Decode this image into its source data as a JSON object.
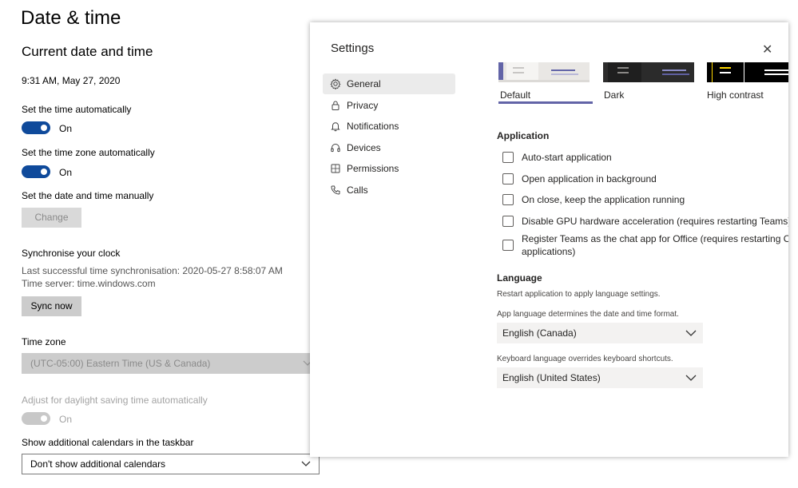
{
  "win": {
    "page_title": "Date & time",
    "section_title": "Current date and time",
    "current_datetime": "9:31 AM, May 27, 2020",
    "auto_time": {
      "label": "Set the time automatically",
      "state": "On"
    },
    "auto_zone": {
      "label": "Set the time zone automatically",
      "state": "On"
    },
    "manual": {
      "label": "Set the date and time manually",
      "button": "Change"
    },
    "sync": {
      "title": "Synchronise your clock",
      "last_sync": "Last successful time synchronisation: 2020-05-27 8:58:07 AM",
      "server": "Time server: time.windows.com",
      "button": "Sync now"
    },
    "timezone": {
      "label": "Time zone",
      "value": "(UTC-05:00) Eastern Time (US & Canada)"
    },
    "dst": {
      "label": "Adjust for daylight saving time automatically",
      "state": "On"
    },
    "calendars": {
      "label": "Show additional calendars in the taskbar",
      "value": "Don't show additional calendars"
    }
  },
  "dialog": {
    "title": "Settings",
    "close_glyph": "✕",
    "nav": [
      {
        "label": "General",
        "icon": "gear-icon"
      },
      {
        "label": "Privacy",
        "icon": "lock-icon"
      },
      {
        "label": "Notifications",
        "icon": "bell-icon"
      },
      {
        "label": "Devices",
        "icon": "headset-icon"
      },
      {
        "label": "Permissions",
        "icon": "shield-icon"
      },
      {
        "label": "Calls",
        "icon": "phone-icon"
      }
    ],
    "themes": [
      {
        "label": "Default",
        "selected": true
      },
      {
        "label": "Dark",
        "selected": false
      },
      {
        "label": "High contrast",
        "selected": false
      }
    ],
    "application": {
      "heading": "Application",
      "options": [
        "Auto-start application",
        "Open application in background",
        "On close, keep the application running",
        "Disable GPU hardware acceleration (requires restarting Teams)",
        "Register Teams as the chat app for Office (requires restarting Office",
        "applications)"
      ]
    },
    "language": {
      "heading": "Language",
      "restart_note": "Restart application to apply language settings.",
      "app_note": "App language determines the date and time format.",
      "app_value": "English (Canada)",
      "keyboard_note": "Keyboard language overrides keyboard shortcuts.",
      "keyboard_value": "English (United States)"
    },
    "colors": {
      "accent": "#6264a7",
      "toggle_on": "#0f4a9b"
    }
  }
}
